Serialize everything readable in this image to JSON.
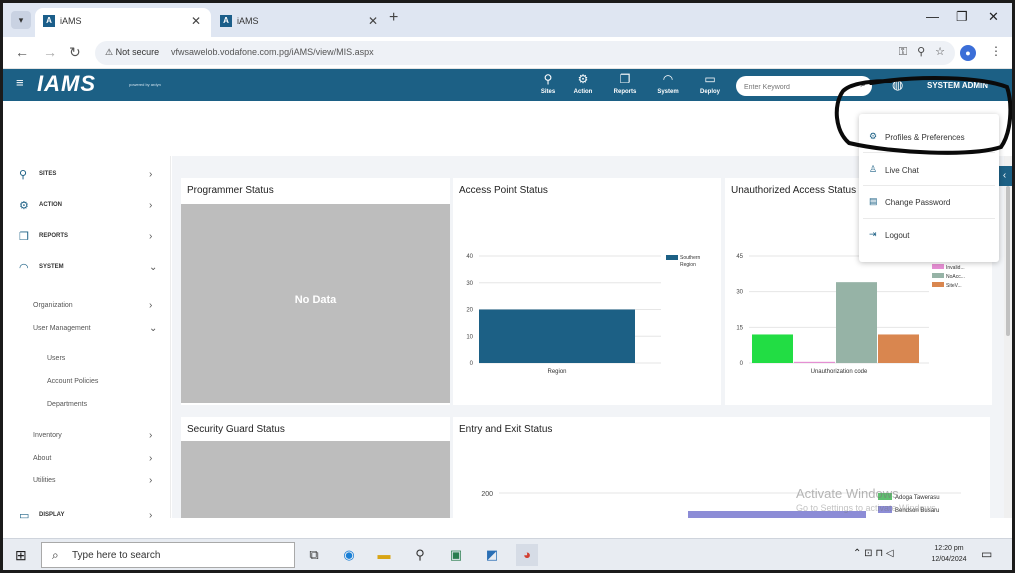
{
  "browser": {
    "tabs": [
      {
        "favicon": "A",
        "title": "iAMS",
        "close": "✕"
      },
      {
        "favicon": "A",
        "title": "iAMS",
        "close": "✕"
      }
    ],
    "new_tab": "+",
    "address": {
      "secure_label": "Not secure",
      "url": "vfwsawelob.vodafone.com.pg/iAMS/view/MIS.aspx"
    }
  },
  "app": {
    "logo": "IAMS",
    "powered_by": "powered by ardyn",
    "nav": [
      {
        "icon": "tower-icon",
        "label": "Sites"
      },
      {
        "icon": "gear-icon",
        "label": "Action"
      },
      {
        "icon": "reports-icon",
        "label": "Reports"
      },
      {
        "icon": "gauge-icon",
        "label": "System"
      },
      {
        "icon": "display-icon",
        "label": "Deploy"
      }
    ],
    "search_placeholder": "Enter Keyword",
    "user": "SYSTEM ADMIN"
  },
  "sidebar": {
    "items": [
      {
        "icon": "tower-icon",
        "label": "SITES"
      },
      {
        "icon": "gear-icon",
        "label": "ACTION"
      },
      {
        "icon": "reports-icon",
        "label": "REPORTS"
      },
      {
        "icon": "gauge-icon",
        "label": "SYSTEM"
      }
    ],
    "system_sub": [
      "Organization",
      "User Management"
    ],
    "user_mgmt_sub": [
      "Users",
      "Account Policies",
      "Departments"
    ],
    "more_sub": [
      "Inventory",
      "About",
      "Utilities"
    ],
    "display": {
      "icon": "display-icon",
      "label": "DISPLAY"
    }
  },
  "dashboard": {
    "programmer_title": "Programmer Status",
    "no_data": "No Data",
    "access_title": "Access Point Status",
    "unauth_title": "Unauthorized Access Status",
    "security_title": "Security Guard Status",
    "entry_title": "Entry and Exit Status"
  },
  "chart_data": [
    {
      "type": "bar",
      "title": "Access Point Status",
      "categories": [
        "Region"
      ],
      "series": [
        {
          "name": "Southern Region",
          "values": [
            20
          ],
          "color": "#1c6085"
        }
      ],
      "ylim": [
        0,
        40
      ],
      "yticks": [
        0,
        10,
        20,
        30,
        40
      ],
      "xlabel": "Region",
      "grid": true,
      "legend": "top-right"
    },
    {
      "type": "bar",
      "title": "Unauthorized Access Status",
      "categories": [
        "Unauthorization code"
      ],
      "series": [
        {
          "value": 12,
          "color": "#22dd44"
        },
        {
          "name": "Invalid...",
          "value": 0.5,
          "color": "#e58fd3"
        },
        {
          "name": "NoAcc...",
          "value": 34,
          "color": "#96b3a6"
        },
        {
          "name": "SiteV...",
          "value": 12,
          "color": "#d9864f"
        }
      ],
      "ylim": [
        0,
        45
      ],
      "yticks": [
        0,
        15,
        30,
        45
      ],
      "xlabel": "Unauthorization code",
      "grid": true,
      "legend": "top-right"
    },
    {
      "type": "bar",
      "title": "Entry and Exit Status",
      "yticks": [
        200
      ],
      "series": [
        {
          "name": "Adoga Tawerasu",
          "color": "#5fbf6f"
        },
        {
          "name": "Bendson Busaru",
          "color": "#8c8cd6"
        }
      ],
      "legend": "right"
    }
  ],
  "dropdown": {
    "items": [
      {
        "icon": "settings-icon",
        "label": "Profiles & Preferences"
      },
      {
        "icon": "user-icon",
        "label": "Live Chat"
      },
      {
        "icon": "password-icon",
        "label": "Change Password"
      },
      {
        "icon": "logout-icon",
        "label": "Logout"
      }
    ]
  },
  "watermark": {
    "line1": "Activate Windows",
    "line2": "Go to Settings to activate Windows."
  },
  "taskbar": {
    "search_placeholder": "Type here to search",
    "time": "12:20 pm",
    "date": "12/04/2024"
  }
}
